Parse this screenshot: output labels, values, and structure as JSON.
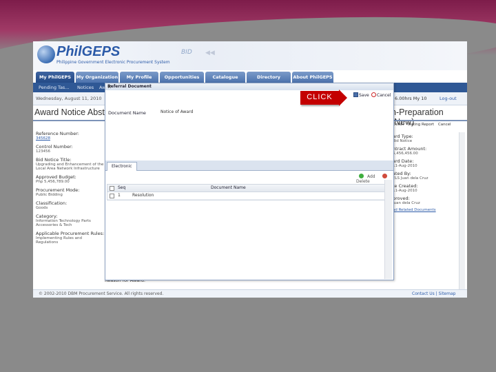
{
  "header": {
    "logo_text": "PhilGEPS",
    "logo_subtitle": "Philippine Government Electronic Procurement System",
    "bid_text": "BID"
  },
  "nav": {
    "tabs": [
      "My PhilGEPS",
      "My Organization",
      "My Profile",
      "Opportunities",
      "Catalogue",
      "Directory",
      "About PhilGEPS"
    ]
  },
  "subnav": {
    "items": [
      "Pending Tas...",
      "Notices",
      "Aw"
    ]
  },
  "infobar": {
    "date": "Wednesday, August 11, 2010",
    "jobs": "6.00hrs  My 10",
    "logout": "Log-out"
  },
  "page": {
    "title": "Award Notice Abstract",
    "status": "n-Preparation (New)",
    "reason_label": "Reason for Award:"
  },
  "left_fields": [
    {
      "label": "Reference Number:",
      "value": "345628",
      "link": true
    },
    {
      "label": "Control Number:",
      "value": "123456",
      "link": false
    },
    {
      "label": "Bid Notice Title:",
      "value": "Upgrading and Enhancement of the Local Area Network Infrastructure",
      "link": false
    },
    {
      "label": "Approved Budget:",
      "value": "Php 5,456,789.00",
      "link": false
    },
    {
      "label": "Procurement Mode:",
      "value": "Public Bidding",
      "link": false
    },
    {
      "label": "Classification:",
      "value": "Goods",
      "link": false
    },
    {
      "label": "Category:",
      "value": "Information Technology Parts Accessories & Tech",
      "link": false
    },
    {
      "label": "Applicable Procurement Rules:",
      "value": "Implementing Rules and Regulations",
      "link": false
    }
  ],
  "right_panel": {
    "tools": [
      "Detail",
      "Dating Report",
      "Cancel"
    ],
    "fields": [
      {
        "label": "ard Type:",
        "value": "Bid Notice"
      },
      {
        "label": "ntract Amount:",
        "value": "5,456,456.00"
      },
      {
        "label": "ard Date:",
        "value": "11-Aug-2010"
      },
      {
        "label": "ated By:",
        "value": "ELS Juan dela Cruz"
      },
      {
        "label": "te Created:",
        "value": "11-Aug-2010"
      },
      {
        "label": "proved:",
        "value": "Juan dela Cruz"
      },
      {
        "label": "",
        "value": "ad Related Documents"
      }
    ]
  },
  "footer": {
    "copyright": "© 2002-2010 DBM Procurement Service. All rights reserved.",
    "links": "Contact Us | Sitemap"
  },
  "modal": {
    "title": "Referral Document",
    "close": "×",
    "save_label": "Save",
    "cancel_label": "Cancel",
    "document_name_label": "Document Name",
    "document_name_value": "Notice of Award",
    "tab_label": "Electronic",
    "add_label": "Add",
    "delete_label": "Delete",
    "columns": {
      "seq": "Seq",
      "document_name": "Document Name"
    },
    "rows": [
      {
        "seq": "1",
        "document_name": "Resolution"
      }
    ]
  },
  "callout": {
    "text": "CLICK",
    "color": "#c40000"
  }
}
